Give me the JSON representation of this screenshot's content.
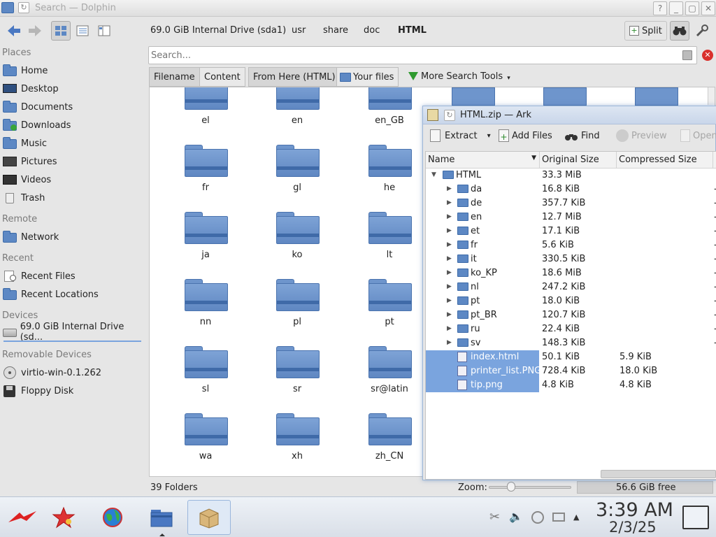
{
  "window": {
    "title": "Search — Dolphin"
  },
  "toolbar": {
    "breadcrumbs": [
      "69.0 GiB Internal Drive (sda1)",
      "usr",
      "share",
      "doc",
      "HTML"
    ],
    "split_label": "Split"
  },
  "sidebar": {
    "places_heading": "Places",
    "places": [
      "Home",
      "Desktop",
      "Documents",
      "Downloads",
      "Music",
      "Pictures",
      "Videos",
      "Trash"
    ],
    "remote_heading": "Remote",
    "remote": [
      "Network"
    ],
    "recent_heading": "Recent",
    "recent": [
      "Recent Files",
      "Recent Locations"
    ],
    "devices_heading": "Devices",
    "devices": [
      "69.0 GiB Internal Drive (sd..."
    ],
    "removable_heading": "Removable Devices",
    "removable": [
      "virtio-win-0.1.262",
      "Floppy Disk"
    ]
  },
  "search": {
    "placeholder": "Search...",
    "filters": {
      "filename": "Filename",
      "content": "Content",
      "from_here": "From Here (HTML)",
      "your_files": "Your files",
      "more_tools": "More Search Tools"
    }
  },
  "grid": {
    "rows": [
      [
        "el",
        "en",
        "en_GB"
      ],
      [
        "fr",
        "gl",
        "he"
      ],
      [
        "ja",
        "ko",
        "lt"
      ],
      [
        "nn",
        "pl",
        "pt"
      ],
      [
        "sl",
        "sr",
        "sr@latin"
      ],
      [
        "wa",
        "xh",
        "zh_CN"
      ]
    ]
  },
  "status": {
    "folders": "39 Folders",
    "zoom_label": "Zoom:",
    "free_space": "56.6 GiB free"
  },
  "ark": {
    "title": "HTML.zip — Ark",
    "toolbar": {
      "extract": "Extract",
      "add_files": "Add Files",
      "find": "Find",
      "preview": "Preview",
      "open": "Open"
    },
    "columns": [
      "Name",
      "Original Size",
      "Compressed Size"
    ],
    "root": {
      "name": "HTML",
      "size": "33.3 MiB"
    },
    "folders": [
      {
        "name": "da",
        "size": "16.8 KiB"
      },
      {
        "name": "de",
        "size": "357.7 KiB"
      },
      {
        "name": "en",
        "size": "12.7 MiB"
      },
      {
        "name": "et",
        "size": "17.1 KiB"
      },
      {
        "name": "fr",
        "size": "5.6 KiB"
      },
      {
        "name": "it",
        "size": "330.5 KiB"
      },
      {
        "name": "ko_KP",
        "size": "18.6 MiB"
      },
      {
        "name": "nl",
        "size": "247.2 KiB"
      },
      {
        "name": "pt",
        "size": "18.0 KiB"
      },
      {
        "name": "pt_BR",
        "size": "120.7 KiB"
      },
      {
        "name": "ru",
        "size": "22.4 KiB"
      },
      {
        "name": "sv",
        "size": "148.3 KiB"
      }
    ],
    "files": [
      {
        "name": "index.html",
        "size": "50.1 KiB",
        "compressed": "5.9 KiB"
      },
      {
        "name": "printer_list.PNG",
        "size": "728.4 KiB",
        "compressed": "18.0 KiB"
      },
      {
        "name": "tip.png",
        "size": "4.8 KiB",
        "compressed": "4.8 KiB"
      }
    ]
  },
  "taskbar": {
    "time": "3:39 AM",
    "date": "2/3/25"
  }
}
